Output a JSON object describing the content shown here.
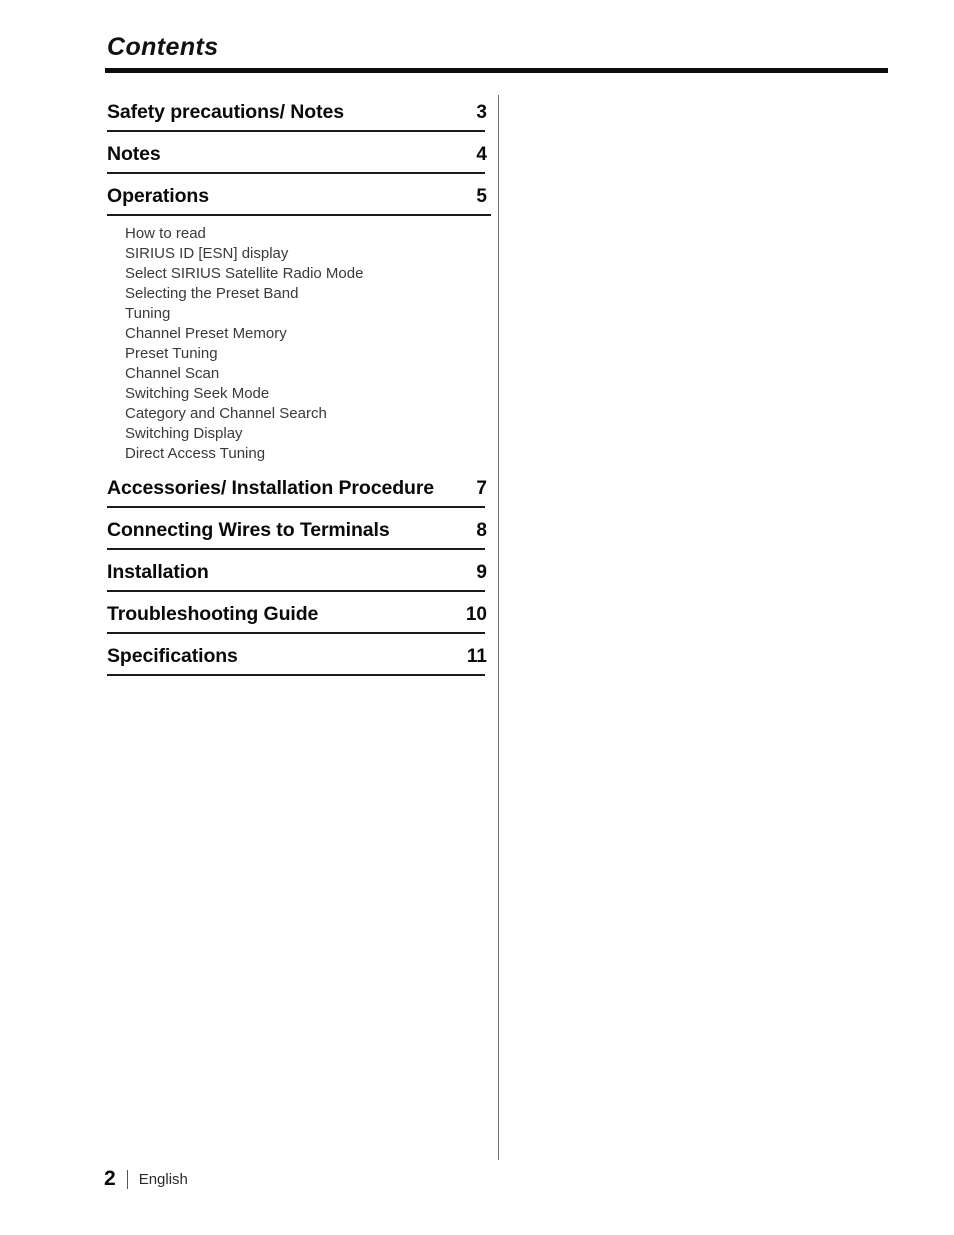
{
  "document": {
    "title": "Contents",
    "page_number": "2",
    "language": "English"
  },
  "toc": {
    "entries": [
      {
        "label": "Safety precautions/ Notes",
        "page": "3",
        "wide_rule": false
      },
      {
        "label": "Notes",
        "page": "4",
        "wide_rule": false
      },
      {
        "label": "Operations",
        "page": "5",
        "wide_rule": true
      },
      {
        "label": "Accessories/ Installation Procedure",
        "page": "7",
        "wide_rule": false
      },
      {
        "label": "Connecting Wires to Terminals",
        "page": "8",
        "wide_rule": false
      },
      {
        "label": "Installation",
        "page": "9",
        "wide_rule": false
      },
      {
        "label": "Troubleshooting Guide",
        "page": "10",
        "wide_rule": false
      },
      {
        "label": "Specifications",
        "page": "11",
        "wide_rule": false
      }
    ],
    "operations_subentries": [
      "How to read",
      "SIRIUS ID [ESN] display",
      "Select SIRIUS Satellite Radio Mode",
      "Selecting the Preset Band",
      "Tuning",
      "Channel Preset Memory",
      "Preset Tuning",
      "Channel Scan",
      "Switching Seek Mode",
      "Category and Channel Search",
      "Switching Display",
      "Direct Access Tuning"
    ]
  }
}
